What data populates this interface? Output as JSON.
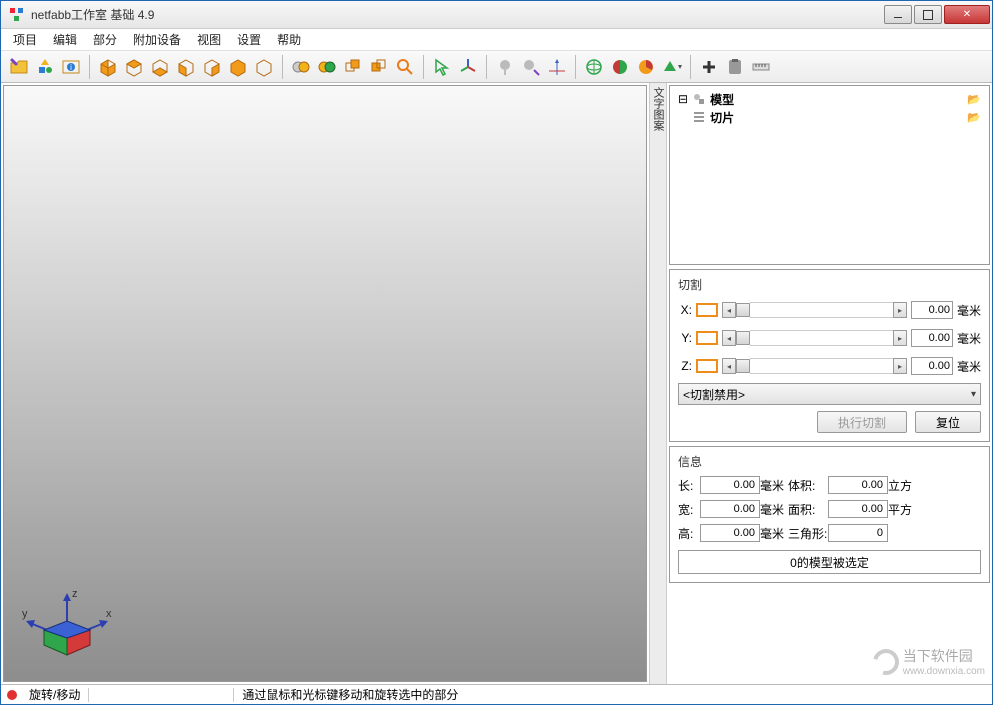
{
  "window": {
    "title": "netfabb工作室 基础 4.9"
  },
  "menu": {
    "items": [
      "项目",
      "编辑",
      "部分",
      "附加设备",
      "视图",
      "设置",
      "帮助"
    ]
  },
  "vertical_tab": "文字图案",
  "tree": {
    "items": [
      {
        "label": "模型",
        "icon": "shapes-icon"
      },
      {
        "label": "切片",
        "icon": "list-icon"
      }
    ]
  },
  "cutting": {
    "title": "切割",
    "axes": [
      {
        "label": "X:",
        "value": "0.00",
        "unit": "毫米"
      },
      {
        "label": "Y:",
        "value": "0.00",
        "unit": "毫米"
      },
      {
        "label": "Z:",
        "value": "0.00",
        "unit": "毫米"
      }
    ],
    "mode": "<切割禁用>",
    "execute_label": "执行切割",
    "reset_label": "复位"
  },
  "info": {
    "title": "信息",
    "rows": [
      {
        "label": "长:",
        "value": "0.00",
        "unit": "毫米",
        "label2": "体积:",
        "value2": "0.00",
        "unit2": "立方"
      },
      {
        "label": "宽:",
        "value": "0.00",
        "unit": "毫米",
        "label2": "面积:",
        "value2": "0.00",
        "unit2": "平方"
      },
      {
        "label": "高:",
        "value": "0.00",
        "unit": "毫米",
        "label2": "三角形:",
        "value2": "0",
        "unit2": ""
      }
    ],
    "selection": "0的模型被选定"
  },
  "axis_labels": {
    "x": "x",
    "y": "y",
    "z": "z"
  },
  "status": {
    "mode": "旋转/移动",
    "hint": "通过鼠标和光标键移动和旋转选中的部分"
  },
  "watermark": {
    "text": "当下软件园",
    "url": "www.downxia.com"
  }
}
